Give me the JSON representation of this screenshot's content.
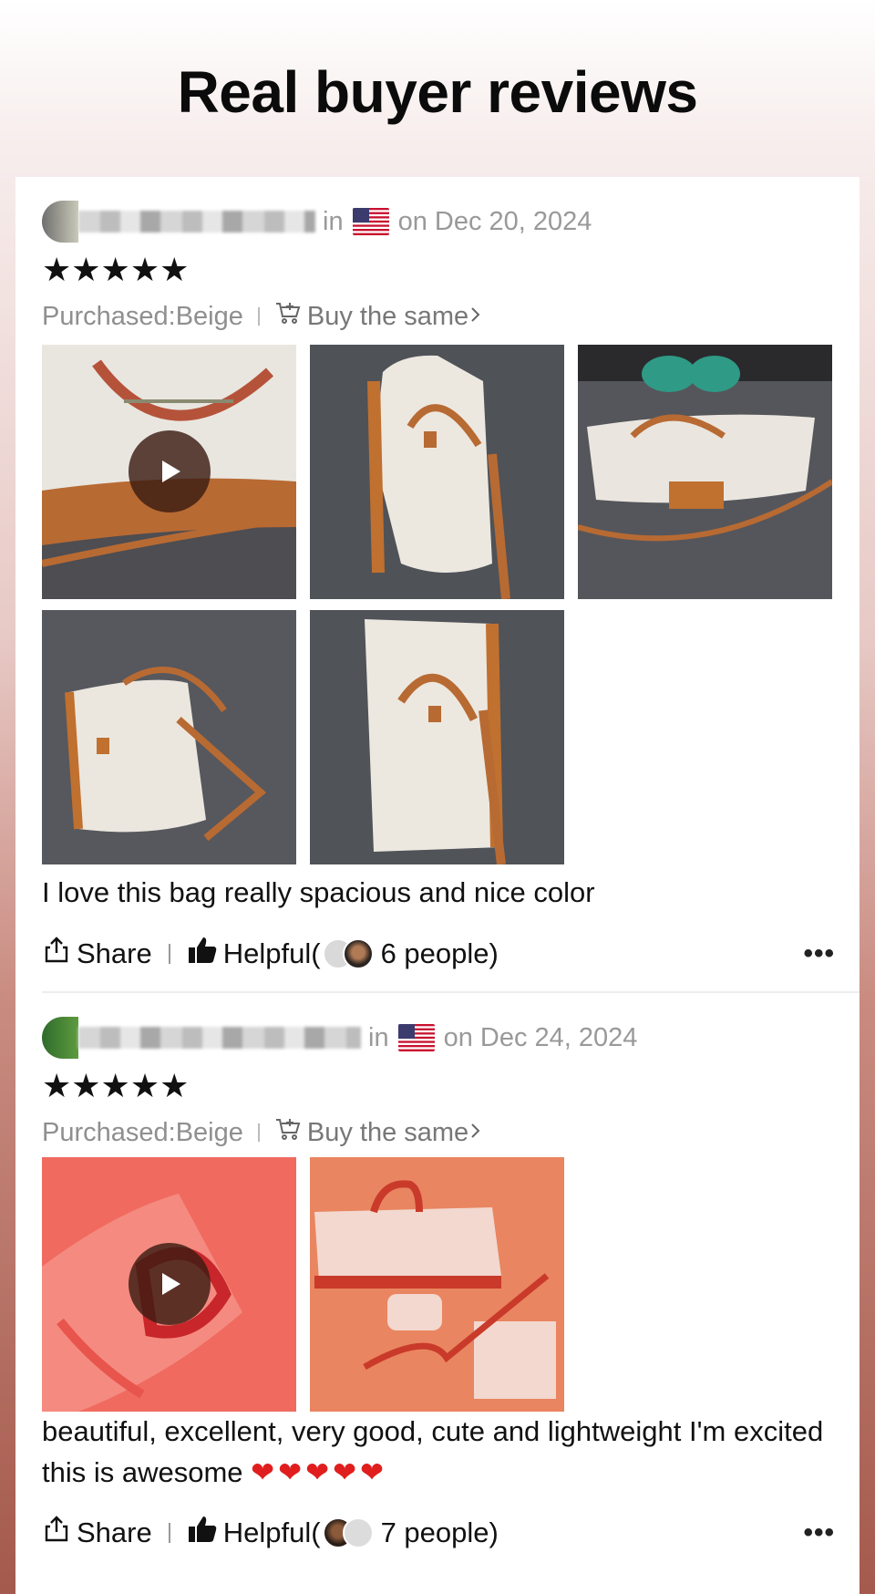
{
  "page_title": "Real buyer reviews",
  "reviews": [
    {
      "in_label": "in",
      "date": "on Dec 20, 2024",
      "stars": "★★★★★",
      "purchased": "Purchased:Beige",
      "buy_same": "Buy the same",
      "text": "I love this bag really spacious and nice color",
      "share": "Share",
      "helpful_prefix": "Helpful(",
      "helpful_count": "6 people)",
      "more": "•••",
      "photo_count": 5,
      "has_video": true
    },
    {
      "in_label": "in",
      "date": "on Dec 24, 2024",
      "stars": "★★★★★",
      "purchased": "Purchased:Beige",
      "buy_same": "Buy the same",
      "text": "beautiful, excellent, very good, cute and lightweight I'm excited this is awesome",
      "hearts": "❤❤❤❤❤",
      "share": "Share",
      "helpful_prefix": "Helpful(",
      "helpful_count": "7 people)",
      "more": "•••",
      "photo_count": 2,
      "has_video": true
    }
  ],
  "icons": {
    "flag": "us-flag-icon",
    "cart": "cart-plus-icon",
    "share": "share-icon",
    "helpful": "thumbs-up-icon",
    "play": "play-icon",
    "chevron": "chevron-right-icon",
    "more": "more-dots-icon"
  },
  "colors": {
    "accent_red": "#e01e1e",
    "muted_text": "#999999"
  }
}
